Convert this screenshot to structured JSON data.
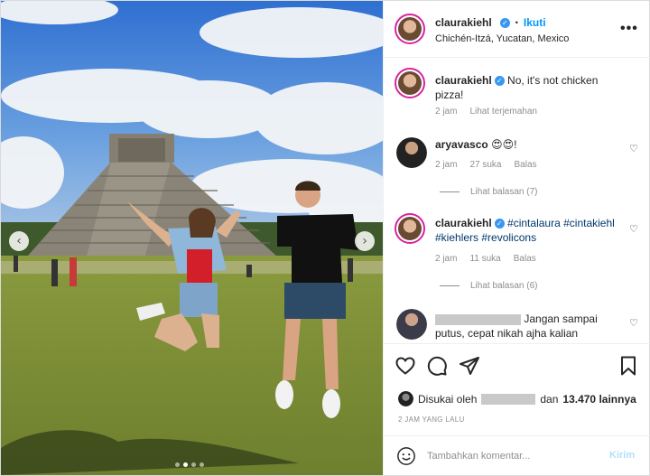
{
  "photo": {
    "alt_subject": "Couple jumping in front of Chichen Itza pyramid",
    "carousel_dots": 4,
    "active_dot": 1,
    "prev_arrow": "‹",
    "next_arrow": "›"
  },
  "header": {
    "username": "claurakiehl",
    "follow_sep": "•",
    "follow_label": "Ikuti",
    "location": "Chichén-Itzá, Yucatan, Mexico",
    "more_icon": "•••"
  },
  "caption": {
    "username": "claurakiehl",
    "text": "No, it's not chicken pizza!",
    "time": "2 jam",
    "translate": "Lihat terjemahan"
  },
  "comments": [
    {
      "username": "aryavasco",
      "text": "😍😍!",
      "time": "2 jam",
      "likes": "27 suka",
      "reply": "Balas",
      "view_replies": "Lihat balasan (7)"
    },
    {
      "username": "claurakiehl",
      "tags": [
        "#cintalaura",
        "#cintakiehl",
        "#kiehlers",
        "#revolicons"
      ],
      "time": "2 jam",
      "likes": "11 suka",
      "reply": "Balas",
      "view_replies": "Lihat balasan (6)"
    },
    {
      "text": "Jangan sampai putus, cepat nikah ajha kalian"
    }
  ],
  "likes": {
    "prefix": "Disukai oleh",
    "middle": "dan",
    "count": "13.470 lainnya"
  },
  "timestamp": "2 JAM YANG LALU",
  "add_comment": {
    "placeholder": "Tambahkan komentar...",
    "post_label": "Kirim"
  },
  "colors": {
    "accent": "#0095f6",
    "hashtag": "#00376b",
    "muted": "#8e8e8e",
    "border": "#efefef"
  },
  "icons": [
    "heart-icon",
    "comment-icon",
    "share-icon",
    "bookmark-icon",
    "emoji-icon",
    "verified-icon",
    "more-icon"
  ]
}
